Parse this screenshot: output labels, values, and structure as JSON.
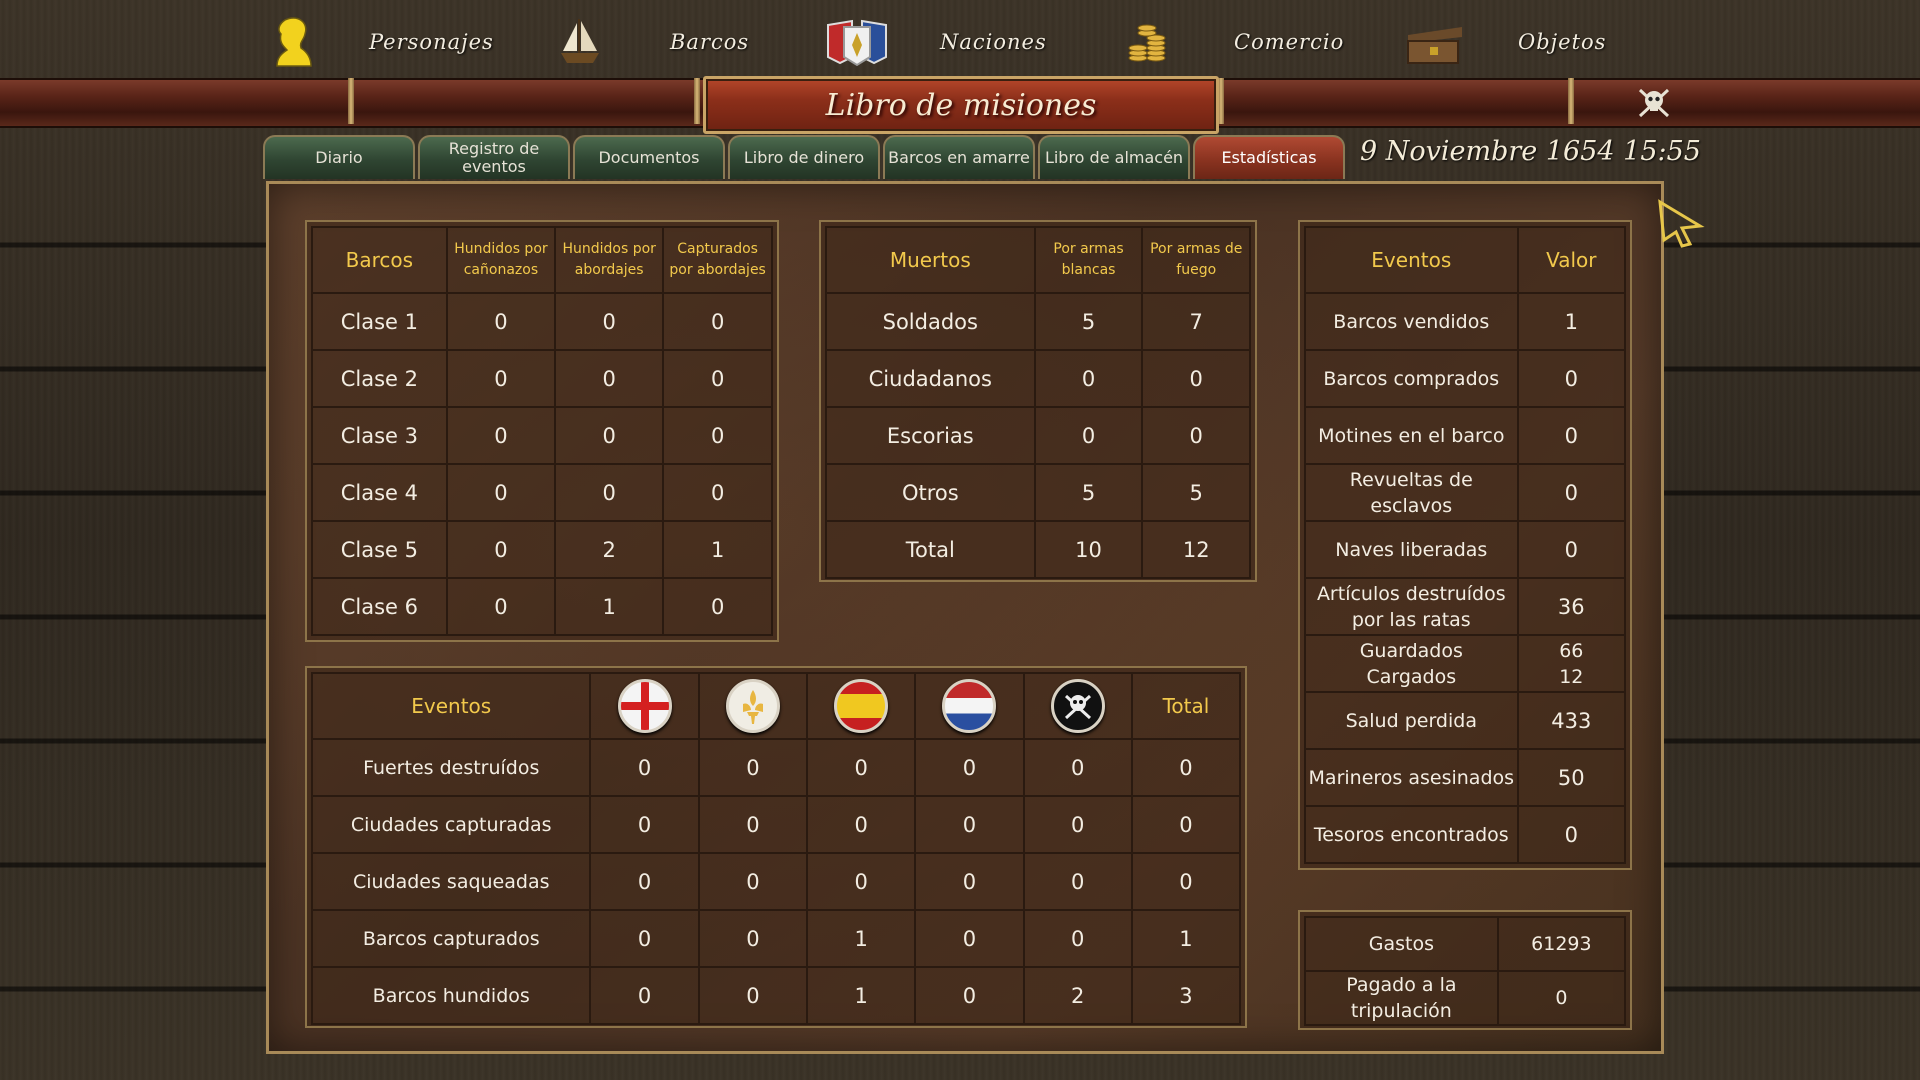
{
  "nav": {
    "items": [
      {
        "label": "Personajes",
        "icon": "character-bust-icon"
      },
      {
        "label": "Barcos",
        "icon": "ship-icon"
      },
      {
        "label": "Naciones",
        "icon": "nations-shield-icon"
      },
      {
        "label": "Comercio",
        "icon": "coins-icon"
      },
      {
        "label": "Objetos",
        "icon": "chest-icon"
      }
    ]
  },
  "title": "Libro de misiones",
  "tabs": [
    {
      "label": "Diario"
    },
    {
      "label": "Registro de eventos"
    },
    {
      "label": "Documentos"
    },
    {
      "label": "Libro de dinero"
    },
    {
      "label": "Barcos en amarre"
    },
    {
      "label": "Libro de almacén"
    },
    {
      "label": "Estadísticas",
      "active": true
    }
  ],
  "date": "9 Noviembre 1654 15:55",
  "ships": {
    "headers": [
      "Barcos",
      "Hundidos por cañonazos",
      "Hundidos por abordajes",
      "Capturados por abordajes"
    ],
    "rows": [
      [
        "Clase 1",
        "0",
        "0",
        "0"
      ],
      [
        "Clase 2",
        "0",
        "0",
        "0"
      ],
      [
        "Clase 3",
        "0",
        "0",
        "0"
      ],
      [
        "Clase 4",
        "0",
        "0",
        "0"
      ],
      [
        "Clase 5",
        "0",
        "2",
        "1"
      ],
      [
        "Clase 6",
        "0",
        "1",
        "0"
      ]
    ]
  },
  "deaths": {
    "headers": [
      "Muertos",
      "Por armas blancas",
      "Por armas de fuego"
    ],
    "rows": [
      [
        "Soldados",
        "5",
        "7"
      ],
      [
        "Ciudadanos",
        "0",
        "0"
      ],
      [
        "Escorias",
        "0",
        "0"
      ],
      [
        "Otros",
        "5",
        "5"
      ],
      [
        "Total",
        "10",
        "12"
      ]
    ]
  },
  "events_values": {
    "headers": [
      "Eventos",
      "Valor"
    ],
    "rows": [
      [
        "Barcos vendidos",
        "1"
      ],
      [
        "Barcos comprados",
        "0"
      ],
      [
        "Motines en el barco",
        "0"
      ],
      [
        "Revueltas de esclavos",
        "0"
      ],
      [
        "Naves liberadas",
        "0"
      ],
      [
        "Artículos destruídos por las ratas",
        "36"
      ],
      [
        "Guardados Cargados",
        "66 12"
      ],
      [
        "Salud perdida",
        "433"
      ],
      [
        "Marineros asesinados",
        "50"
      ],
      [
        "Tesoros encontrados",
        "0"
      ]
    ]
  },
  "nation_events": {
    "header_label": "Eventos",
    "total_label": "Total",
    "nations": [
      {
        "icon": "england-flag-icon",
        "color": "#d42020"
      },
      {
        "icon": "france-flag-icon",
        "color": "#e8b640"
      },
      {
        "icon": "spain-flag-icon",
        "color": "#e8c020"
      },
      {
        "icon": "holland-flag-icon",
        "color": "#2a4fa0"
      },
      {
        "icon": "pirate-flag-icon",
        "color": "#111111"
      }
    ],
    "rows": [
      [
        "Fuertes destruídos",
        "0",
        "0",
        "0",
        "0",
        "0",
        "0"
      ],
      [
        "Ciudades capturadas",
        "0",
        "0",
        "0",
        "0",
        "0",
        "0"
      ],
      [
        "Ciudades saqueadas",
        "0",
        "0",
        "0",
        "0",
        "0",
        "0"
      ],
      [
        "Barcos capturados",
        "0",
        "0",
        "1",
        "0",
        "0",
        "1"
      ],
      [
        "Barcos hundidos",
        "0",
        "0",
        "1",
        "0",
        "2",
        "3"
      ]
    ]
  },
  "expenses": {
    "rows": [
      [
        "Gastos",
        "61293"
      ],
      [
        "Pagado a la tripulación",
        "0"
      ]
    ]
  }
}
